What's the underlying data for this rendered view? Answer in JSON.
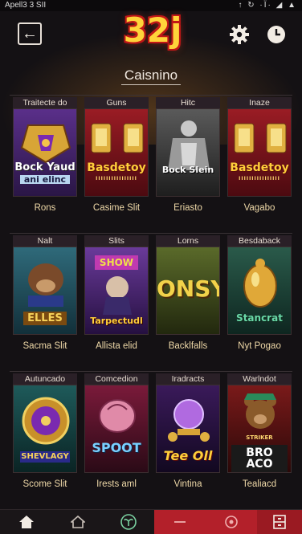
{
  "status_bar": {
    "left": "Apell3 3 SII",
    "right": "↑ ↻ ·Ϊ· ◢ ▲"
  },
  "header": {
    "logo": "32j"
  },
  "section": {
    "title": "Caisnino"
  },
  "rows": [
    {
      "games": [
        {
          "tag": "Traitecte do",
          "title": "Bock Yaud",
          "subtitle": "ani elinc",
          "caption": "Rons",
          "theme": "purple"
        },
        {
          "tag": "Guns",
          "title": "Basdetoy",
          "subtitle": "IIIIIIIIIIIIIIII",
          "caption": "Casime Slit",
          "theme": "red"
        },
        {
          "tag": "Hitc",
          "title": "Bock Slein",
          "subtitle": "",
          "caption": "Eriasto",
          "theme": "grey"
        },
        {
          "tag": "Inaze",
          "title": "Basdetoy",
          "subtitle": "IIIIIIIIIIIIIIII",
          "caption": "Vagabo",
          "theme": "red"
        }
      ]
    },
    {
      "games": [
        {
          "tag": "Nalt",
          "title": "ELLES",
          "subtitle": "",
          "caption": "Sacma Slit",
          "theme": "teal"
        },
        {
          "tag": "Slits",
          "title": "Tarpectudl",
          "subtitle": "SHOW",
          "caption": "Allista elid",
          "theme": "violet"
        },
        {
          "tag": "Lorns",
          "title": "ONSY",
          "subtitle": "",
          "caption": "Backlfalls",
          "theme": "olive"
        },
        {
          "tag": "Besdaback",
          "title": "Stancrat",
          "subtitle": "",
          "caption": "Nyt Pogao",
          "theme": "gold"
        }
      ]
    },
    {
      "games": [
        {
          "tag": "Autuncado",
          "title": "SHEVLAGY",
          "subtitle": "",
          "caption": "Scome Slit",
          "theme": "wheel"
        },
        {
          "tag": "Comcedion",
          "title": "SPOOT",
          "subtitle": "",
          "caption": "Irests aml",
          "theme": "pink"
        },
        {
          "tag": "Iradracts",
          "title": "Tee Oll",
          "subtitle": "",
          "caption": "Vintina",
          "theme": "orb"
        },
        {
          "tag": "Warlndot",
          "title": "BRO ACO",
          "subtitle": "STRIKER",
          "caption": "Tealiacd",
          "theme": "bear"
        }
      ]
    }
  ],
  "bottom_nav": [
    {
      "icon": "home-icon",
      "active": true
    },
    {
      "icon": "house-outline-icon",
      "active": false
    },
    {
      "icon": "sprout-icon",
      "active": false
    },
    {
      "icon": "red-tab-icon",
      "active": false
    },
    {
      "icon": "target-icon",
      "active": false
    },
    {
      "icon": "cabinet-icon",
      "active": false
    }
  ],
  "colors": {
    "accent": "#ffd43a",
    "caption": "#efd9a8",
    "nav_red": "#b3202a"
  }
}
